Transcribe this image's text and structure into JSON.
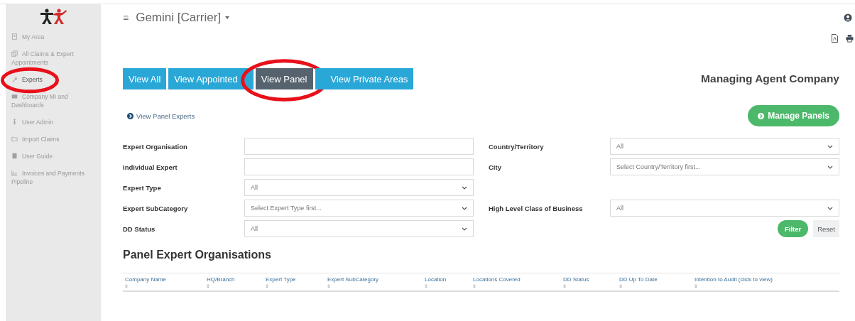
{
  "sidebar": {
    "items": [
      {
        "label": "My Area",
        "selected": false,
        "circled": false
      },
      {
        "label": "All Claims & Expert Appointments",
        "selected": false,
        "circled": false
      },
      {
        "label": "Experts",
        "selected": true,
        "circled": true
      },
      {
        "label": "Company MI and Dashboards",
        "selected": false,
        "circled": false
      },
      {
        "label": "User Admin",
        "selected": false,
        "circled": false
      },
      {
        "label": "Import Claims",
        "selected": false,
        "circled": false
      },
      {
        "label": "User Guide",
        "selected": false,
        "circled": false
      },
      {
        "label": "Invoices and Payments Pipeline",
        "selected": false,
        "circled": false
      }
    ]
  },
  "header": {
    "menu_glyph": "≡",
    "title": "Gemini [Carrier]"
  },
  "tabs": [
    {
      "label": "View All",
      "selected": false,
      "circled": false
    },
    {
      "label": "View Appointed",
      "selected": false,
      "circled": false
    },
    {
      "label": "View Panel",
      "selected": true,
      "circled": true
    },
    {
      "label": "View Private Areas",
      "selected": false,
      "circled": false
    }
  ],
  "company": "Managing Agent Company",
  "panel_link": "View Panel Experts",
  "manage_button": "Manage Panels",
  "filters_left": [
    {
      "label": "Expert Organisation",
      "kind": "text"
    },
    {
      "label": "Individual Expert",
      "kind": "text"
    },
    {
      "label": "Expert Type",
      "kind": "select",
      "value": "All"
    },
    {
      "label": "Expert SubCategory",
      "kind": "select",
      "value": "Select Expert Type first..."
    },
    {
      "label": "DD Status",
      "kind": "select",
      "value": "All"
    }
  ],
  "filters_right": [
    {
      "label": "Country/Territory",
      "kind": "select",
      "value": "All"
    },
    {
      "label": "City",
      "kind": "select",
      "value": "Select Country/Territory first..."
    },
    {
      "kind": "blank"
    },
    {
      "label": "High Level Class of Business",
      "kind": "select",
      "value": "All"
    }
  ],
  "filter_button": "Filter",
  "reset_button": "Reset",
  "table": {
    "title": "Panel Expert Organisations",
    "columns": [
      "Company Name",
      "HQ/Branch",
      "Expert Type",
      "Expert SubCategory",
      "Location",
      "Locations Covered",
      "DD Status",
      "DD Up To Date",
      "Intention to Audit (click to view)"
    ]
  }
}
